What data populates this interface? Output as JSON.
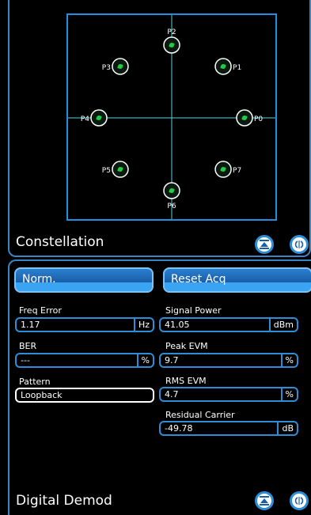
{
  "constellation": {
    "title": "Constellation",
    "points": [
      {
        "label": "P0",
        "x": 1,
        "y": 0
      },
      {
        "label": "P1",
        "x": 0.7071,
        "y": 0.7071
      },
      {
        "label": "P2",
        "x": 0,
        "y": 1
      },
      {
        "label": "P3",
        "x": -0.7071,
        "y": 0.7071
      },
      {
        "label": "P4",
        "x": -1,
        "y": 0
      },
      {
        "label": "P5",
        "x": -0.7071,
        "y": -0.7071
      },
      {
        "label": "P6",
        "x": 0,
        "y": -1
      },
      {
        "label": "P7",
        "x": 0.7071,
        "y": -0.7071
      }
    ]
  },
  "buttons": {
    "norm_label": "Norm.",
    "reset_label": "Reset Acq"
  },
  "fields": {
    "freq_error": {
      "label": "Freq Error",
      "value": "1.17",
      "unit": "Hz"
    },
    "ber": {
      "label": "BER",
      "value": "---",
      "unit": "%"
    },
    "pattern": {
      "label": "Pattern",
      "value": "Loopback"
    },
    "signal_power": {
      "label": "Signal Power",
      "value": "41.05",
      "unit": "dBm"
    },
    "peak_evm": {
      "label": "Peak EVM",
      "value": "9.7",
      "unit": "%"
    },
    "rms_evm": {
      "label": "RMS EVM",
      "value": "4.7",
      "unit": "%"
    },
    "residual_carrier": {
      "label": "Residual Carrier",
      "value": "-49.78",
      "unit": "dB"
    }
  },
  "bottom_panel": {
    "title": "Digital Demod"
  },
  "colors": {
    "accent": "#2d8ed8",
    "axis": "#5ad0e0",
    "point": "#22cc44"
  }
}
